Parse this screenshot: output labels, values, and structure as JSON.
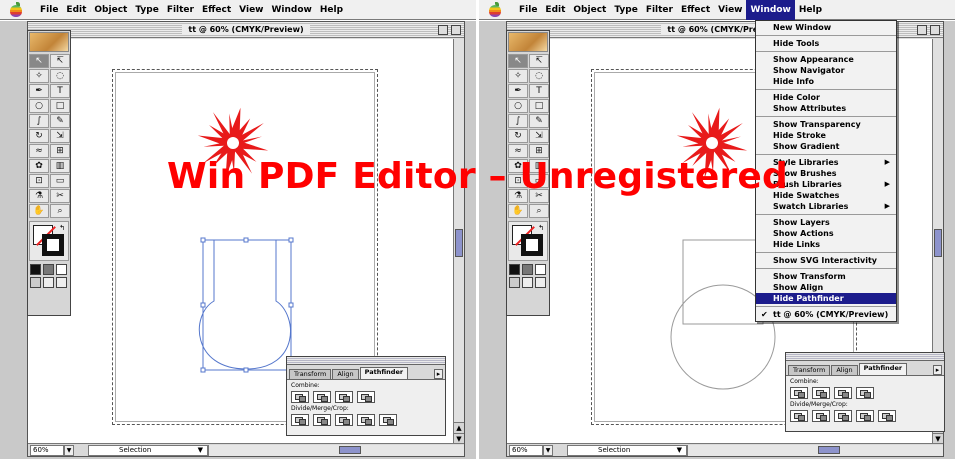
{
  "menubar": {
    "items": [
      "File",
      "Edit",
      "Object",
      "Type",
      "Filter",
      "Effect",
      "View",
      "Window",
      "Help"
    ],
    "active_item": "Window"
  },
  "document": {
    "title": "tt @ 60% (CMYK/Preview)",
    "zoom": "60%",
    "tool_status": "Selection"
  },
  "pathfinder_palette": {
    "tabs": [
      "Transform",
      "Align",
      "Pathfinder"
    ],
    "active_tab": "Pathfinder",
    "combine_label": "Combine:",
    "divide_label": "Divide/Merge/Crop:"
  },
  "window_menu": {
    "items": [
      {
        "label": "New Window"
      },
      {
        "label": "Hide Tools"
      },
      {
        "label": "Show Appearance"
      },
      {
        "label": "Show Navigator"
      },
      {
        "label": "Hide Info"
      },
      {
        "label": "Hide Color"
      },
      {
        "label": "Show Attributes"
      },
      {
        "label": "Show Transparency"
      },
      {
        "label": "Hide Stroke"
      },
      {
        "label": "Show Gradient"
      },
      {
        "label": "Style Libraries",
        "submenu": true
      },
      {
        "label": "Show Brushes"
      },
      {
        "label": "Brush Libraries",
        "submenu": true
      },
      {
        "label": "Hide Swatches"
      },
      {
        "label": "Swatch Libraries",
        "submenu": true
      },
      {
        "label": "Show Layers"
      },
      {
        "label": "Show Actions"
      },
      {
        "label": "Hide Links"
      },
      {
        "label": "Show SVG Interactivity"
      },
      {
        "label": "Show Transform"
      },
      {
        "label": "Show Align"
      },
      {
        "label": "Hide Pathfinder",
        "highlighted": true
      },
      {
        "label": "tt @ 60% (CMYK/Preview)",
        "checked": true
      }
    ]
  },
  "watermark": "Win PDF Editor – Unregistered",
  "colors": {
    "menu_highlight": "#1c1c8c",
    "path_outline": "#5577cc",
    "starburst": "#e81a1a",
    "watermark": "#ff0000"
  }
}
